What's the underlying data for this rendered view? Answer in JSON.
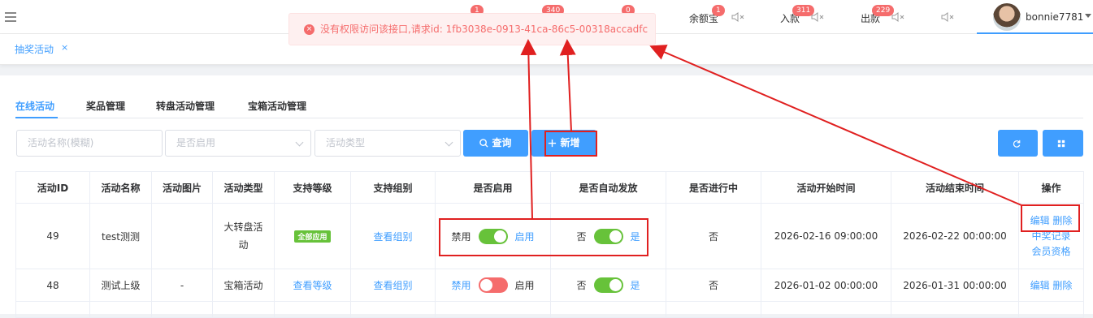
{
  "topbar": {
    "badges": [
      "1",
      "340",
      "0"
    ],
    "balance_label": "余额宝",
    "balance_badge": "1",
    "deposit_label": "入款",
    "deposit_badge": "311",
    "withdraw_label": "出款",
    "withdraw_badge": "229",
    "username": "bonnie7781"
  },
  "tagbar": {
    "active_tag": "抽奖活动",
    "close": "×"
  },
  "toast": {
    "message": "没有权限访问该接口,请求id: 1fb3038e-0913-41ca-86c5-00318accadfc",
    "icon": "×"
  },
  "tabs": [
    "在线活动",
    "奖品管理",
    "转盘活动管理",
    "宝箱活动管理"
  ],
  "filters": {
    "name_placeholder": "活动名称(模糊)",
    "enabled_placeholder": "是否启用",
    "type_placeholder": "活动类型",
    "query_button": "查询",
    "add_button": "新增"
  },
  "table": {
    "headers": [
      "活动ID",
      "活动名称",
      "活动图片",
      "活动类型",
      "支持等级",
      "支持组别",
      "是否启用",
      "是否自动发放",
      "是否进行中",
      "活动开始时间",
      "活动结束时间",
      "操作"
    ],
    "rows": [
      {
        "id": "49",
        "name": "test测测",
        "image": "",
        "type": "大转盘活动",
        "level": "全部应用",
        "group": "查看组别",
        "enabled_off": "禁用",
        "enabled_on": "启用",
        "enabled": true,
        "auto_off": "否",
        "auto_on": "是",
        "auto": true,
        "running": "否",
        "start": "2026-02-16 09:00:00",
        "end": "2026-02-22 00:00:00",
        "actions": [
          "编辑",
          "删除",
          "中奖记录",
          "会员资格"
        ]
      },
      {
        "id": "48",
        "name": "测试上级",
        "image": "-",
        "type": "宝箱活动",
        "level": "查看等级",
        "group": "查看组别",
        "enabled_off": "禁用",
        "enabled_on": "启用",
        "enabled": false,
        "auto_off": "否",
        "auto_on": "是",
        "auto": true,
        "running": "否",
        "start": "2026-01-02 00:00:00",
        "end": "2026-01-31 00:00:00",
        "actions": [
          "编辑",
          "删除"
        ]
      }
    ]
  },
  "colors": {
    "primary": "#409eff",
    "success": "#67c23a",
    "danger": "#f56c6c",
    "annotation": "#e02020"
  }
}
